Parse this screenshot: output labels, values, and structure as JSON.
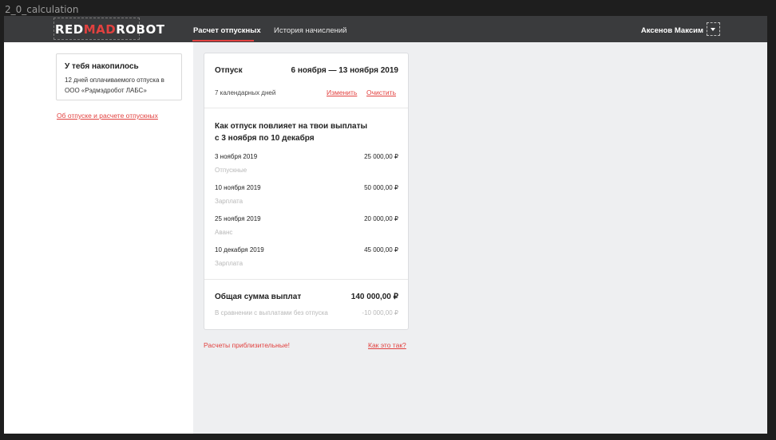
{
  "frame": {
    "label": "2_0_calculation"
  },
  "header": {
    "logo": {
      "part1": "RED",
      "part2": "MAD",
      "part3": "ROBOT"
    },
    "tabs": [
      {
        "label": "Расчет отпускных",
        "active": true
      },
      {
        "label": "История начислений",
        "active": false
      }
    ],
    "user_name": "Аксенов Максим"
  },
  "sidebar": {
    "accumulated": {
      "title": "У тебя накопилось",
      "text": "12 дней оплачиваемого отпуска в ООО «Рэдмэдробот ЛАБС»"
    },
    "info_link": "Об отпуске и расчете отпускных"
  },
  "vacation": {
    "label": "Отпуск",
    "dates": "6 ноября — 13 ноября 2019",
    "days": "7 календарных дней",
    "edit_label": "Изменить",
    "clear_label": "Очистить"
  },
  "impact": {
    "title_line1": "Как отпуск повлияет на твои выплаты",
    "title_line2": "с 3 ноября по 10 декабря",
    "payments": [
      {
        "date": "3 ноября 2019",
        "type": "Отпускные",
        "amount": "25 000,00 ₽"
      },
      {
        "date": "10 ноября 2019",
        "type": "Зарплата",
        "amount": "50 000,00 ₽"
      },
      {
        "date": "25 ноября 2019",
        "type": "Аванс",
        "amount": "20 000,00 ₽"
      },
      {
        "date": "10 декабря 2019",
        "type": "Зарплата",
        "amount": "45 000,00 ₽"
      }
    ]
  },
  "total": {
    "label": "Общая сумма выплат",
    "amount": "140 000,00 ₽",
    "compare_label": "В сравнении с выплатами без отпуска",
    "compare_amount": "-10 000,00 ₽"
  },
  "footer": {
    "approx_note": "Расчеты приблизительные!",
    "how_link": "Как это так?"
  },
  "colors": {
    "accent": "#e2413f",
    "topbar": "#3a3b3d",
    "main_bg": "#eeeff1"
  }
}
